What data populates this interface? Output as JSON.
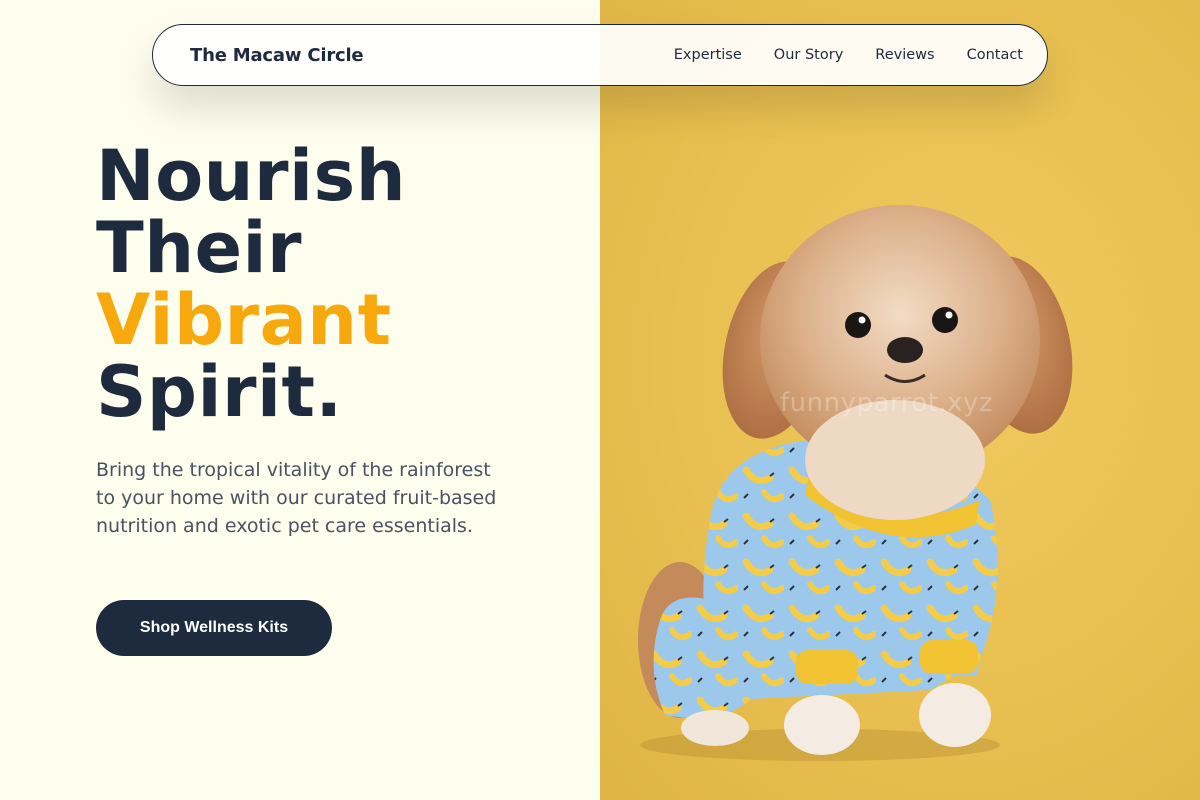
{
  "nav": {
    "brand": "The Macaw Circle",
    "links": [
      "Expertise",
      "Our Story",
      "Reviews",
      "Contact"
    ]
  },
  "hero": {
    "headline_line1": "Nourish",
    "headline_line2": "Their",
    "headline_accent": "Vibrant",
    "headline_line4": "Spirit.",
    "lede": "Bring the tropical vitality of the rainforest to your home with our curated fruit-based nutrition and exotic pet care essentials.",
    "cta_label": "Shop Wellness Kits"
  },
  "image": {
    "watermark": "funnyparrot.xyz"
  },
  "colors": {
    "background": "#fefeee",
    "navy": "#1e2a3e",
    "accent": "#f7a80d",
    "photo_bg": "#e8bf50"
  }
}
